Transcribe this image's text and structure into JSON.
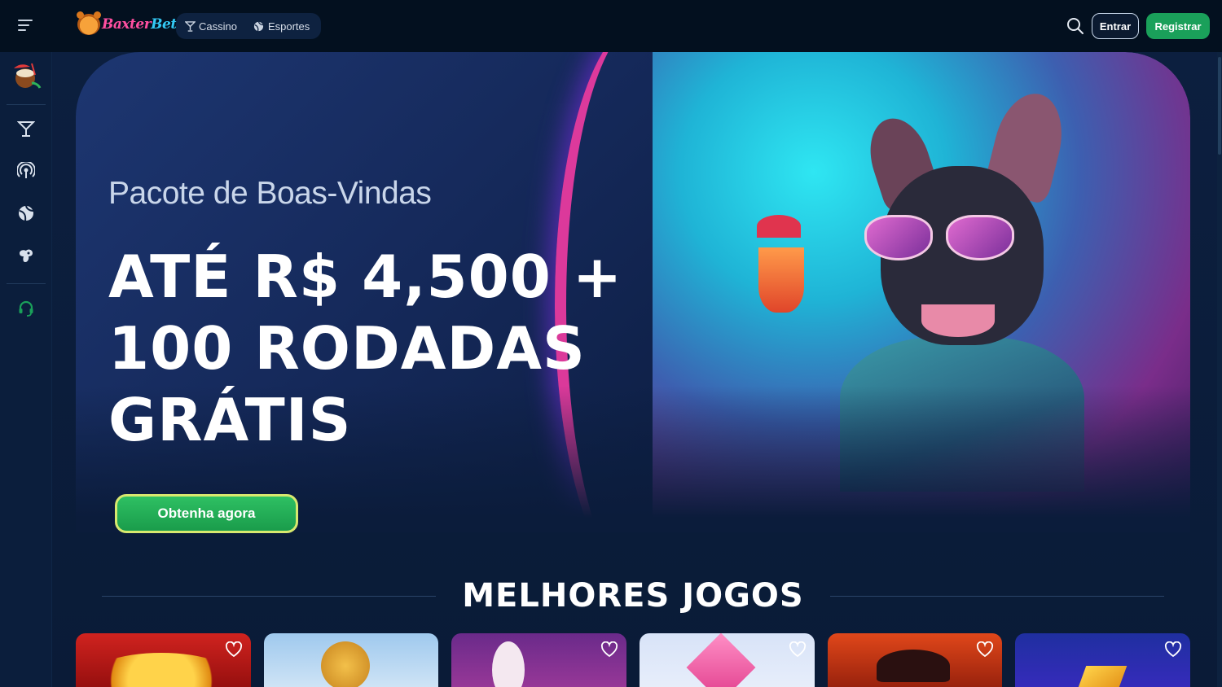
{
  "brand": {
    "part1": "Baxter",
    "part2": "Bet"
  },
  "nav": {
    "items": [
      {
        "label": "Cassino",
        "icon": "cocktail-icon"
      },
      {
        "label": "Esportes",
        "icon": "globe-ball-icon"
      }
    ]
  },
  "header": {
    "login_label": "Entrar",
    "register_label": "Registrar"
  },
  "sidebar": {
    "items": [
      {
        "name": "promo-coconut",
        "icon": "coconut-drink-icon"
      },
      {
        "name": "casino",
        "icon": "cocktail-icon"
      },
      {
        "name": "live",
        "icon": "broadcast-icon"
      },
      {
        "name": "sports",
        "icon": "sports-ball-icon"
      },
      {
        "name": "virtual",
        "icon": "gamepad-icon"
      },
      {
        "name": "support",
        "icon": "headset-icon"
      }
    ]
  },
  "hero": {
    "subtitle": "Pacote de Boas-Vindas",
    "title_line1": "ATÉ R$ 4,500 +",
    "title_line2": "100 RODADAS",
    "title_line3": "GRÁTIS",
    "cta_label": "Obtenha agora"
  },
  "games_section": {
    "title": "MELHORES JOGOS"
  },
  "colors": {
    "accent_green": "#1aa05a",
    "bg_dark": "#03101f",
    "hero_blue": "#1d3671",
    "brand_pink": "#ff4fa0",
    "brand_cyan": "#33c9f5"
  }
}
